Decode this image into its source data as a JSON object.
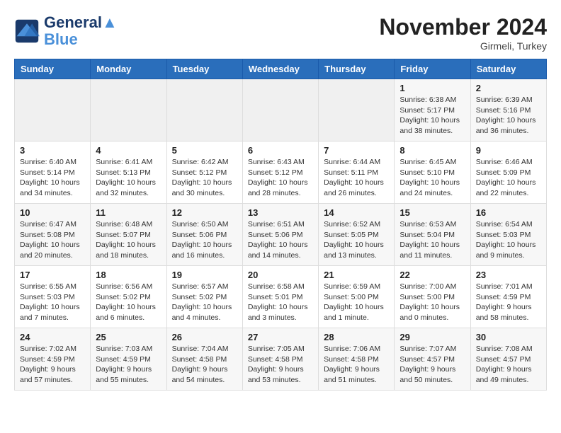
{
  "logo": {
    "line1": "General",
    "line2": "Blue"
  },
  "title": "November 2024",
  "location": "Girmeli, Turkey",
  "days_of_week": [
    "Sunday",
    "Monday",
    "Tuesday",
    "Wednesday",
    "Thursday",
    "Friday",
    "Saturday"
  ],
  "weeks": [
    [
      {
        "day": "",
        "info": ""
      },
      {
        "day": "",
        "info": ""
      },
      {
        "day": "",
        "info": ""
      },
      {
        "day": "",
        "info": ""
      },
      {
        "day": "",
        "info": ""
      },
      {
        "day": "1",
        "info": "Sunrise: 6:38 AM\nSunset: 5:17 PM\nDaylight: 10 hours\nand 38 minutes."
      },
      {
        "day": "2",
        "info": "Sunrise: 6:39 AM\nSunset: 5:16 PM\nDaylight: 10 hours\nand 36 minutes."
      }
    ],
    [
      {
        "day": "3",
        "info": "Sunrise: 6:40 AM\nSunset: 5:14 PM\nDaylight: 10 hours\nand 34 minutes."
      },
      {
        "day": "4",
        "info": "Sunrise: 6:41 AM\nSunset: 5:13 PM\nDaylight: 10 hours\nand 32 minutes."
      },
      {
        "day": "5",
        "info": "Sunrise: 6:42 AM\nSunset: 5:12 PM\nDaylight: 10 hours\nand 30 minutes."
      },
      {
        "day": "6",
        "info": "Sunrise: 6:43 AM\nSunset: 5:12 PM\nDaylight: 10 hours\nand 28 minutes."
      },
      {
        "day": "7",
        "info": "Sunrise: 6:44 AM\nSunset: 5:11 PM\nDaylight: 10 hours\nand 26 minutes."
      },
      {
        "day": "8",
        "info": "Sunrise: 6:45 AM\nSunset: 5:10 PM\nDaylight: 10 hours\nand 24 minutes."
      },
      {
        "day": "9",
        "info": "Sunrise: 6:46 AM\nSunset: 5:09 PM\nDaylight: 10 hours\nand 22 minutes."
      }
    ],
    [
      {
        "day": "10",
        "info": "Sunrise: 6:47 AM\nSunset: 5:08 PM\nDaylight: 10 hours\nand 20 minutes."
      },
      {
        "day": "11",
        "info": "Sunrise: 6:48 AM\nSunset: 5:07 PM\nDaylight: 10 hours\nand 18 minutes."
      },
      {
        "day": "12",
        "info": "Sunrise: 6:50 AM\nSunset: 5:06 PM\nDaylight: 10 hours\nand 16 minutes."
      },
      {
        "day": "13",
        "info": "Sunrise: 6:51 AM\nSunset: 5:06 PM\nDaylight: 10 hours\nand 14 minutes."
      },
      {
        "day": "14",
        "info": "Sunrise: 6:52 AM\nSunset: 5:05 PM\nDaylight: 10 hours\nand 13 minutes."
      },
      {
        "day": "15",
        "info": "Sunrise: 6:53 AM\nSunset: 5:04 PM\nDaylight: 10 hours\nand 11 minutes."
      },
      {
        "day": "16",
        "info": "Sunrise: 6:54 AM\nSunset: 5:03 PM\nDaylight: 10 hours\nand 9 minutes."
      }
    ],
    [
      {
        "day": "17",
        "info": "Sunrise: 6:55 AM\nSunset: 5:03 PM\nDaylight: 10 hours\nand 7 minutes."
      },
      {
        "day": "18",
        "info": "Sunrise: 6:56 AM\nSunset: 5:02 PM\nDaylight: 10 hours\nand 6 minutes."
      },
      {
        "day": "19",
        "info": "Sunrise: 6:57 AM\nSunset: 5:02 PM\nDaylight: 10 hours\nand 4 minutes."
      },
      {
        "day": "20",
        "info": "Sunrise: 6:58 AM\nSunset: 5:01 PM\nDaylight: 10 hours\nand 3 minutes."
      },
      {
        "day": "21",
        "info": "Sunrise: 6:59 AM\nSunset: 5:00 PM\nDaylight: 10 hours\nand 1 minute."
      },
      {
        "day": "22",
        "info": "Sunrise: 7:00 AM\nSunset: 5:00 PM\nDaylight: 10 hours\nand 0 minutes."
      },
      {
        "day": "23",
        "info": "Sunrise: 7:01 AM\nSunset: 4:59 PM\nDaylight: 9 hours\nand 58 minutes."
      }
    ],
    [
      {
        "day": "24",
        "info": "Sunrise: 7:02 AM\nSunset: 4:59 PM\nDaylight: 9 hours\nand 57 minutes."
      },
      {
        "day": "25",
        "info": "Sunrise: 7:03 AM\nSunset: 4:59 PM\nDaylight: 9 hours\nand 55 minutes."
      },
      {
        "day": "26",
        "info": "Sunrise: 7:04 AM\nSunset: 4:58 PM\nDaylight: 9 hours\nand 54 minutes."
      },
      {
        "day": "27",
        "info": "Sunrise: 7:05 AM\nSunset: 4:58 PM\nDaylight: 9 hours\nand 53 minutes."
      },
      {
        "day": "28",
        "info": "Sunrise: 7:06 AM\nSunset: 4:58 PM\nDaylight: 9 hours\nand 51 minutes."
      },
      {
        "day": "29",
        "info": "Sunrise: 7:07 AM\nSunset: 4:57 PM\nDaylight: 9 hours\nand 50 minutes."
      },
      {
        "day": "30",
        "info": "Sunrise: 7:08 AM\nSunset: 4:57 PM\nDaylight: 9 hours\nand 49 minutes."
      }
    ]
  ]
}
